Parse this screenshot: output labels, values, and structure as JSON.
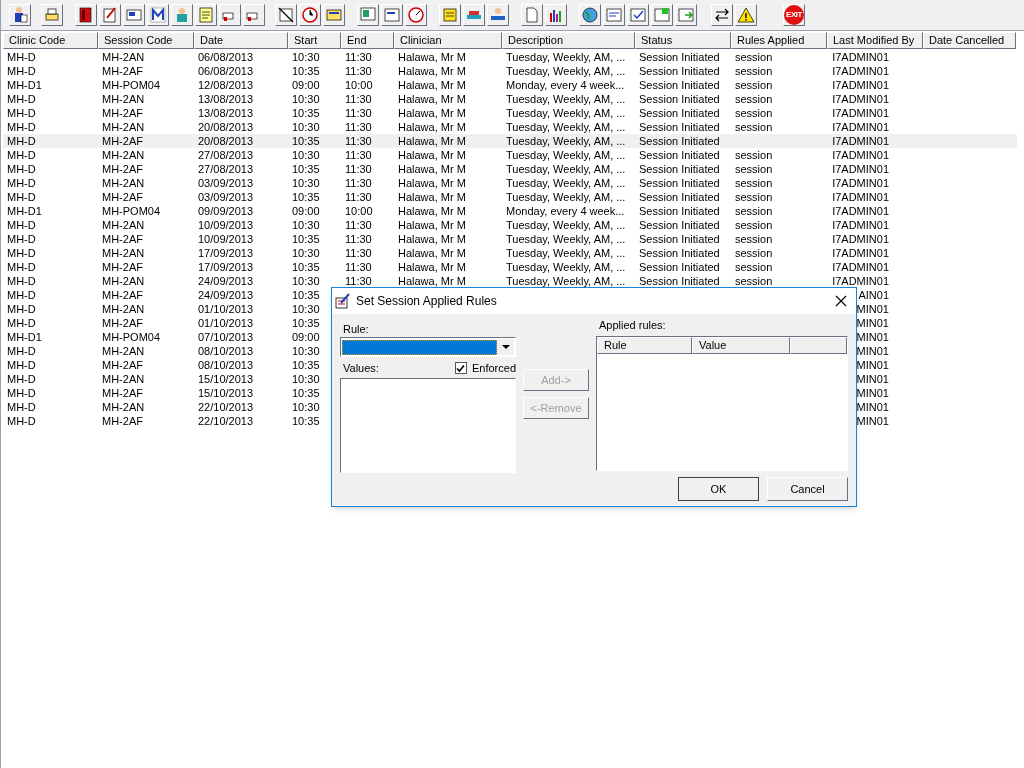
{
  "toolbar": {
    "exit_label": "EXIT"
  },
  "table": {
    "columns": [
      "Clinic Code",
      "Session Code",
      "Date",
      "Start",
      "End",
      "Clinician",
      "Description",
      "Status",
      "Rules Applied",
      "Last Modified By",
      "Date Cancelled"
    ],
    "rows": [
      {
        "selected": false,
        "clinic": "MH-D",
        "session": "MH-2AN",
        "date": "06/08/2013",
        "start": "10:30",
        "end": "11:30",
        "clinician": "Halawa, Mr M",
        "description": "Tuesday, Weekly, AM, ...",
        "status": "Session Initiated",
        "rules_applied": "session",
        "last_modified_by": "I7ADMIN01"
      },
      {
        "selected": false,
        "clinic": "MH-D",
        "session": "MH-2AF",
        "date": "06/08/2013",
        "start": "10:35",
        "end": "11:30",
        "clinician": "Halawa, Mr M",
        "description": "Tuesday, Weekly, AM, ...",
        "status": "Session Initiated",
        "rules_applied": "session",
        "last_modified_by": "I7ADMIN01"
      },
      {
        "selected": false,
        "clinic": "MH-D1",
        "session": "MH-POM04",
        "date": "12/08/2013",
        "start": "09:00",
        "end": "10:00",
        "clinician": "Halawa, Mr M",
        "description": "Monday, every 4 week...",
        "status": "Session Initiated",
        "rules_applied": "session",
        "last_modified_by": "I7ADMIN01"
      },
      {
        "selected": false,
        "clinic": "MH-D",
        "session": "MH-2AN",
        "date": "13/08/2013",
        "start": "10:30",
        "end": "11:30",
        "clinician": "Halawa, Mr M",
        "description": "Tuesday, Weekly, AM, ...",
        "status": "Session Initiated",
        "rules_applied": "session",
        "last_modified_by": "I7ADMIN01"
      },
      {
        "selected": false,
        "clinic": "MH-D",
        "session": "MH-2AF",
        "date": "13/08/2013",
        "start": "10:35",
        "end": "11:30",
        "clinician": "Halawa, Mr M",
        "description": "Tuesday, Weekly, AM, ...",
        "status": "Session Initiated",
        "rules_applied": "session",
        "last_modified_by": "I7ADMIN01"
      },
      {
        "selected": false,
        "clinic": "MH-D",
        "session": "MH-2AN",
        "date": "20/08/2013",
        "start": "10:30",
        "end": "11:30",
        "clinician": "Halawa, Mr M",
        "description": "Tuesday, Weekly, AM, ...",
        "status": "Session Initiated",
        "rules_applied": "session",
        "last_modified_by": "I7ADMIN01"
      },
      {
        "selected": true,
        "clinic": "MH-D",
        "session": "MH-2AF",
        "date": "20/08/2013",
        "start": "10:35",
        "end": "11:30",
        "clinician": "Halawa, Mr M",
        "description": "Tuesday, Weekly, AM, ...",
        "status": "Session Initiated",
        "last_modified_by": "I7ADMIN01"
      },
      {
        "selected": false,
        "clinic": "MH-D",
        "session": "MH-2AN",
        "date": "27/08/2013",
        "start": "10:30",
        "end": "11:30",
        "clinician": "Halawa, Mr M",
        "description": "Tuesday, Weekly, AM, ...",
        "status": "Session Initiated",
        "rules_applied": "session",
        "last_modified_by": "I7ADMIN01"
      },
      {
        "selected": false,
        "clinic": "MH-D",
        "session": "MH-2AF",
        "date": "27/08/2013",
        "start": "10:35",
        "end": "11:30",
        "clinician": "Halawa, Mr M",
        "description": "Tuesday, Weekly, AM, ...",
        "status": "Session Initiated",
        "rules_applied": "session",
        "last_modified_by": "I7ADMIN01"
      },
      {
        "selected": false,
        "clinic": "MH-D",
        "session": "MH-2AN",
        "date": "03/09/2013",
        "start": "10:30",
        "end": "11:30",
        "clinician": "Halawa, Mr M",
        "description": "Tuesday, Weekly, AM, ...",
        "status": "Session Initiated",
        "rules_applied": "session",
        "last_modified_by": "I7ADMIN01"
      },
      {
        "selected": false,
        "clinic": "MH-D",
        "session": "MH-2AF",
        "date": "03/09/2013",
        "start": "10:35",
        "end": "11:30",
        "clinician": "Halawa, Mr M",
        "description": "Tuesday, Weekly, AM, ...",
        "status": "Session Initiated",
        "rules_applied": "session",
        "last_modified_by": "I7ADMIN01"
      },
      {
        "selected": false,
        "clinic": "MH-D1",
        "session": "MH-POM04",
        "date": "09/09/2013",
        "start": "09:00",
        "end": "10:00",
        "clinician": "Halawa, Mr M",
        "description": "Monday, every 4 week...",
        "status": "Session Initiated",
        "rules_applied": "session",
        "last_modified_by": "I7ADMIN01"
      },
      {
        "selected": false,
        "clinic": "MH-D",
        "session": "MH-2AN",
        "date": "10/09/2013",
        "start": "10:30",
        "end": "11:30",
        "clinician": "Halawa, Mr M",
        "description": "Tuesday, Weekly, AM, ...",
        "status": "Session Initiated",
        "rules_applied": "session",
        "last_modified_by": "I7ADMIN01"
      },
      {
        "selected": false,
        "clinic": "MH-D",
        "session": "MH-2AF",
        "date": "10/09/2013",
        "start": "10:35",
        "end": "11:30",
        "clinician": "Halawa, Mr M",
        "description": "Tuesday, Weekly, AM, ...",
        "status": "Session Initiated",
        "rules_applied": "session",
        "last_modified_by": "I7ADMIN01"
      },
      {
        "selected": false,
        "clinic": "MH-D",
        "session": "MH-2AN",
        "date": "17/09/2013",
        "start": "10:30",
        "end": "11:30",
        "clinician": "Halawa, Mr M",
        "description": "Tuesday, Weekly, AM, ...",
        "status": "Session Initiated",
        "rules_applied": "session",
        "last_modified_by": "I7ADMIN01"
      },
      {
        "selected": false,
        "clinic": "MH-D",
        "session": "MH-2AF",
        "date": "17/09/2013",
        "start": "10:35",
        "end": "11:30",
        "clinician": "Halawa, Mr M",
        "description": "Tuesday, Weekly, AM, ...",
        "status": "Session Initiated",
        "rules_applied": "session",
        "last_modified_by": "I7ADMIN01"
      },
      {
        "selected": false,
        "clinic": "MH-D",
        "session": "MH-2AN",
        "date": "24/09/2013",
        "start": "10:30",
        "end": "11:30",
        "clinician": "Halawa, Mr M",
        "description": "Tuesday, Weekly, AM, ...",
        "status": "Session Initiated",
        "rules_applied": "session",
        "last_modified_by": "I7ADMIN01"
      },
      {
        "selected": false,
        "clinic": "MH-D",
        "session": "MH-2AF",
        "date": "24/09/2013",
        "start": "10:35",
        "last_modified_by": "AIN01"
      },
      {
        "selected": false,
        "clinic": "MH-D",
        "session": "MH-2AN",
        "date": "01/10/2013",
        "start": "10:30",
        "last_modified_by": "MIN01"
      },
      {
        "selected": false,
        "clinic": "MH-D",
        "session": "MH-2AF",
        "date": "01/10/2013",
        "start": "10:35",
        "last_modified_by": "MIN01"
      },
      {
        "selected": false,
        "clinic": "MH-D1",
        "session": "MH-POM04",
        "date": "07/10/2013",
        "start": "09:00",
        "last_modified_by": "MIN01"
      },
      {
        "selected": false,
        "clinic": "MH-D",
        "session": "MH-2AN",
        "date": "08/10/2013",
        "start": "10:30",
        "last_modified_by": "MIN01"
      },
      {
        "selected": false,
        "clinic": "MH-D",
        "session": "MH-2AF",
        "date": "08/10/2013",
        "start": "10:35",
        "last_modified_by": "MIN01"
      },
      {
        "selected": false,
        "clinic": "MH-D",
        "session": "MH-2AN",
        "date": "15/10/2013",
        "start": "10:30",
        "last_modified_by": "MIN01"
      },
      {
        "selected": false,
        "clinic": "MH-D",
        "session": "MH-2AF",
        "date": "15/10/2013",
        "start": "10:35",
        "last_modified_by": "MIN01"
      },
      {
        "selected": false,
        "clinic": "MH-D",
        "session": "MH-2AN",
        "date": "22/10/2013",
        "start": "10:30",
        "last_modified_by": "MIN01"
      },
      {
        "selected": false,
        "clinic": "MH-D",
        "session": "MH-2AF",
        "date": "22/10/2013",
        "start": "10:35",
        "last_modified_by": "MIN01"
      }
    ]
  },
  "dialog": {
    "title": "Set Session Applied Rules",
    "rule_label": "Rule:",
    "values_label": "Values:",
    "enforced": {
      "label": "Enforced",
      "checked": true
    },
    "add_button": {
      "label": "Add->",
      "disabled": true
    },
    "remove_button": {
      "label": "<-Remove",
      "disabled": true
    },
    "applied_label": "Applied rules:",
    "applied_columns": [
      "Rule",
      "Value"
    ],
    "ok_button": "OK",
    "cancel_button": "Cancel"
  }
}
